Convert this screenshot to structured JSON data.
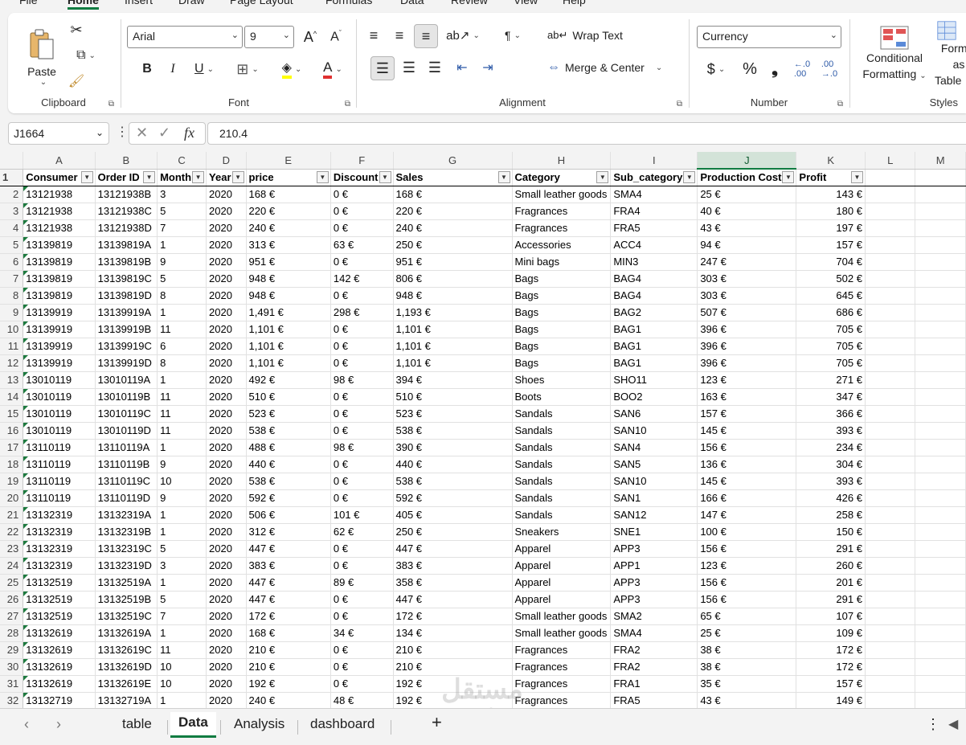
{
  "menu": [
    "File",
    "Home",
    "Insert",
    "Draw",
    "Page Layout",
    "Formulas",
    "Data",
    "Review",
    "View",
    "Help"
  ],
  "ribbon": {
    "clipboard": {
      "label": "Clipboard",
      "paste": "Paste"
    },
    "font": {
      "label": "Font",
      "font_name": "Arial",
      "font_size": "9"
    },
    "alignment": {
      "label": "Alignment",
      "wrap_text": "Wrap Text",
      "merge_center": "Merge & Center"
    },
    "number": {
      "label": "Number",
      "format": "Currency"
    },
    "styles": {
      "label": "Styles",
      "conditional_1": "Conditional",
      "conditional_2": "Formatting",
      "format_table_1": "Format as",
      "format_table_2": "Table"
    }
  },
  "formula_bar": {
    "name_box": "J1664",
    "value": "210.4"
  },
  "columns": [
    "A",
    "B",
    "C",
    "D",
    "E",
    "F",
    "G",
    "H",
    "I",
    "J",
    "K",
    "L",
    "M"
  ],
  "selected_column": "J",
  "headers": [
    "Consumer",
    "Order ID",
    "Month",
    "Year",
    "price",
    "Discount",
    "Sales",
    "Category",
    "Sub_category",
    "Production Cost",
    "Profit"
  ],
  "rows": [
    [
      "13121938",
      "13121938B",
      "3",
      "2020",
      "168 €",
      "0 €",
      "168 €",
      "Small leather goods",
      "SMA4",
      "25 €",
      "143 €"
    ],
    [
      "13121938",
      "13121938C",
      "5",
      "2020",
      "220 €",
      "0 €",
      "220 €",
      "Fragrances",
      "FRA4",
      "40 €",
      "180 €"
    ],
    [
      "13121938",
      "13121938D",
      "7",
      "2020",
      "240 €",
      "0 €",
      "240 €",
      "Fragrances",
      "FRA5",
      "43 €",
      "197 €"
    ],
    [
      "13139819",
      "13139819A",
      "1",
      "2020",
      "313 €",
      "63 €",
      "250 €",
      "Accessories",
      "ACC4",
      "94 €",
      "157 €"
    ],
    [
      "13139819",
      "13139819B",
      "9",
      "2020",
      "951 €",
      "0 €",
      "951 €",
      "Mini bags",
      "MIN3",
      "247 €",
      "704 €"
    ],
    [
      "13139819",
      "13139819C",
      "5",
      "2020",
      "948 €",
      "142 €",
      "806 €",
      "Bags",
      "BAG4",
      "303 €",
      "502 €"
    ],
    [
      "13139819",
      "13139819D",
      "8",
      "2020",
      "948 €",
      "0 €",
      "948 €",
      "Bags",
      "BAG4",
      "303 €",
      "645 €"
    ],
    [
      "13139919",
      "13139919A",
      "1",
      "2020",
      "1,491 €",
      "298 €",
      "1,193 €",
      "Bags",
      "BAG2",
      "507 €",
      "686 €"
    ],
    [
      "13139919",
      "13139919B",
      "11",
      "2020",
      "1,101 €",
      "0 €",
      "1,101 €",
      "Bags",
      "BAG1",
      "396 €",
      "705 €"
    ],
    [
      "13139919",
      "13139919C",
      "6",
      "2020",
      "1,101 €",
      "0 €",
      "1,101 €",
      "Bags",
      "BAG1",
      "396 €",
      "705 €"
    ],
    [
      "13139919",
      "13139919D",
      "8",
      "2020",
      "1,101 €",
      "0 €",
      "1,101 €",
      "Bags",
      "BAG1",
      "396 €",
      "705 €"
    ],
    [
      "13010119",
      "13010119A",
      "1",
      "2020",
      "492 €",
      "98 €",
      "394 €",
      "Shoes",
      "SHO11",
      "123 €",
      "271 €"
    ],
    [
      "13010119",
      "13010119B",
      "11",
      "2020",
      "510 €",
      "0 €",
      "510 €",
      "Boots",
      "BOO2",
      "163 €",
      "347 €"
    ],
    [
      "13010119",
      "13010119C",
      "11",
      "2020",
      "523 €",
      "0 €",
      "523 €",
      "Sandals",
      "SAN6",
      "157 €",
      "366 €"
    ],
    [
      "13010119",
      "13010119D",
      "11",
      "2020",
      "538 €",
      "0 €",
      "538 €",
      "Sandals",
      "SAN10",
      "145 €",
      "393 €"
    ],
    [
      "13110119",
      "13110119A",
      "1",
      "2020",
      "488 €",
      "98 €",
      "390 €",
      "Sandals",
      "SAN4",
      "156 €",
      "234 €"
    ],
    [
      "13110119",
      "13110119B",
      "9",
      "2020",
      "440 €",
      "0 €",
      "440 €",
      "Sandals",
      "SAN5",
      "136 €",
      "304 €"
    ],
    [
      "13110119",
      "13110119C",
      "10",
      "2020",
      "538 €",
      "0 €",
      "538 €",
      "Sandals",
      "SAN10",
      "145 €",
      "393 €"
    ],
    [
      "13110119",
      "13110119D",
      "9",
      "2020",
      "592 €",
      "0 €",
      "592 €",
      "Sandals",
      "SAN1",
      "166 €",
      "426 €"
    ],
    [
      "13132319",
      "13132319A",
      "1",
      "2020",
      "506 €",
      "101 €",
      "405 €",
      "Sandals",
      "SAN12",
      "147 €",
      "258 €"
    ],
    [
      "13132319",
      "13132319B",
      "1",
      "2020",
      "312 €",
      "62 €",
      "250 €",
      "Sneakers",
      "SNE1",
      "100 €",
      "150 €"
    ],
    [
      "13132319",
      "13132319C",
      "5",
      "2020",
      "447 €",
      "0 €",
      "447 €",
      "Apparel",
      "APP3",
      "156 €",
      "291 €"
    ],
    [
      "13132319",
      "13132319D",
      "3",
      "2020",
      "383 €",
      "0 €",
      "383 €",
      "Apparel",
      "APP1",
      "123 €",
      "260 €"
    ],
    [
      "13132519",
      "13132519A",
      "1",
      "2020",
      "447 €",
      "89 €",
      "358 €",
      "Apparel",
      "APP3",
      "156 €",
      "201 €"
    ],
    [
      "13132519",
      "13132519B",
      "5",
      "2020",
      "447 €",
      "0 €",
      "447 €",
      "Apparel",
      "APP3",
      "156 €",
      "291 €"
    ],
    [
      "13132519",
      "13132519C",
      "7",
      "2020",
      "172 €",
      "0 €",
      "172 €",
      "Small leather goods",
      "SMA2",
      "65 €",
      "107 €"
    ],
    [
      "13132619",
      "13132619A",
      "1",
      "2020",
      "168 €",
      "34 €",
      "134 €",
      "Small leather goods",
      "SMA4",
      "25 €",
      "109 €"
    ],
    [
      "13132619",
      "13132619C",
      "11",
      "2020",
      "210 €",
      "0 €",
      "210 €",
      "Fragrances",
      "FRA2",
      "38 €",
      "172 €"
    ],
    [
      "13132619",
      "13132619D",
      "10",
      "2020",
      "210 €",
      "0 €",
      "210 €",
      "Fragrances",
      "FRA2",
      "38 €",
      "172 €"
    ],
    [
      "13132619",
      "13132619E",
      "10",
      "2020",
      "192 €",
      "0 €",
      "192 €",
      "Fragrances",
      "FRA1",
      "35 €",
      "157 €"
    ],
    [
      "13132719",
      "13132719A",
      "1",
      "2020",
      "240 €",
      "48 €",
      "192 €",
      "Fragrances",
      "FRA5",
      "43 €",
      "149 €"
    ]
  ],
  "sheet_tabs": [
    "table",
    "Data",
    "Analysis",
    "dashboard"
  ],
  "active_tab": "Data",
  "watermark": {
    "arabic": "مستقل",
    "latin": "mostaql.com"
  },
  "colors": {
    "accent": "#107c41",
    "selected_header": "#d3e3d8"
  }
}
